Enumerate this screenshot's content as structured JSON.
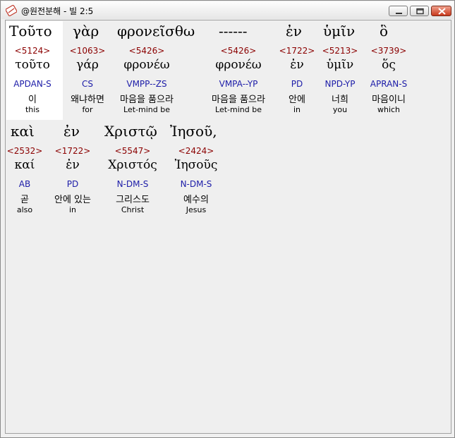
{
  "window": {
    "title": "@원전분해 - 빌 2:5",
    "icons": {
      "app": "bible-app-icon",
      "minimize": "minimize-icon",
      "maximize": "maximize-icon",
      "close": "close-icon"
    }
  },
  "lines": [
    {
      "words": [
        {
          "greek": "Τοῦτο",
          "strong": "<5124>",
          "lemma": "τοῦτο",
          "parsing": "APDAN-S",
          "korean": "이",
          "english": "this"
        },
        {
          "greek": "γὰρ",
          "strong": "<1063>",
          "lemma": "γάρ",
          "parsing": "CS",
          "korean": "왜냐하면",
          "english": "for"
        },
        {
          "greek": "φρονεῖσθω",
          "strong": "<5426>",
          "lemma": "φρονέω",
          "parsing": "VMPP--ZS",
          "korean": "마음을 품으라",
          "english": "Let-mind be"
        },
        {
          "greek": "------",
          "strong": "<5426>",
          "lemma": "φρονέω",
          "parsing": "VMPA--YP",
          "korean": "마음을 품으라",
          "english": "Let-mind be"
        },
        {
          "greek": "ἐν",
          "strong": "<1722>",
          "lemma": "ἐν",
          "parsing": "PD",
          "korean": "안에",
          "english": "in"
        },
        {
          "greek": "ὑμῖν",
          "strong": "<5213>",
          "lemma": "ὑμῖν",
          "parsing": "NPD-YP",
          "korean": "너희",
          "english": "you"
        },
        {
          "greek": "ὃ",
          "strong": "<3739>",
          "lemma": "ὅς",
          "parsing": "APRAN-S",
          "korean": "마음이니",
          "english": "which"
        }
      ]
    },
    {
      "words": [
        {
          "greek": "καὶ",
          "strong": "<2532>",
          "lemma": "καί",
          "parsing": "AB",
          "korean": "곧",
          "english": "also"
        },
        {
          "greek": "ἐν",
          "strong": "<1722>",
          "lemma": "ἐν",
          "parsing": "PD",
          "korean": "안에 있는",
          "english": "in"
        },
        {
          "greek": "Χριστῷ",
          "strong": "<5547>",
          "lemma": "Χριστός",
          "parsing": "N-DM-S",
          "korean": "그리스도",
          "english": "Christ"
        },
        {
          "greek": "Ἰησοῦ,",
          "strong": "<2424>",
          "lemma": "Ἰησοῦς",
          "parsing": "N-DM-S",
          "korean": "예수의",
          "english": "Jesus"
        }
      ]
    }
  ]
}
